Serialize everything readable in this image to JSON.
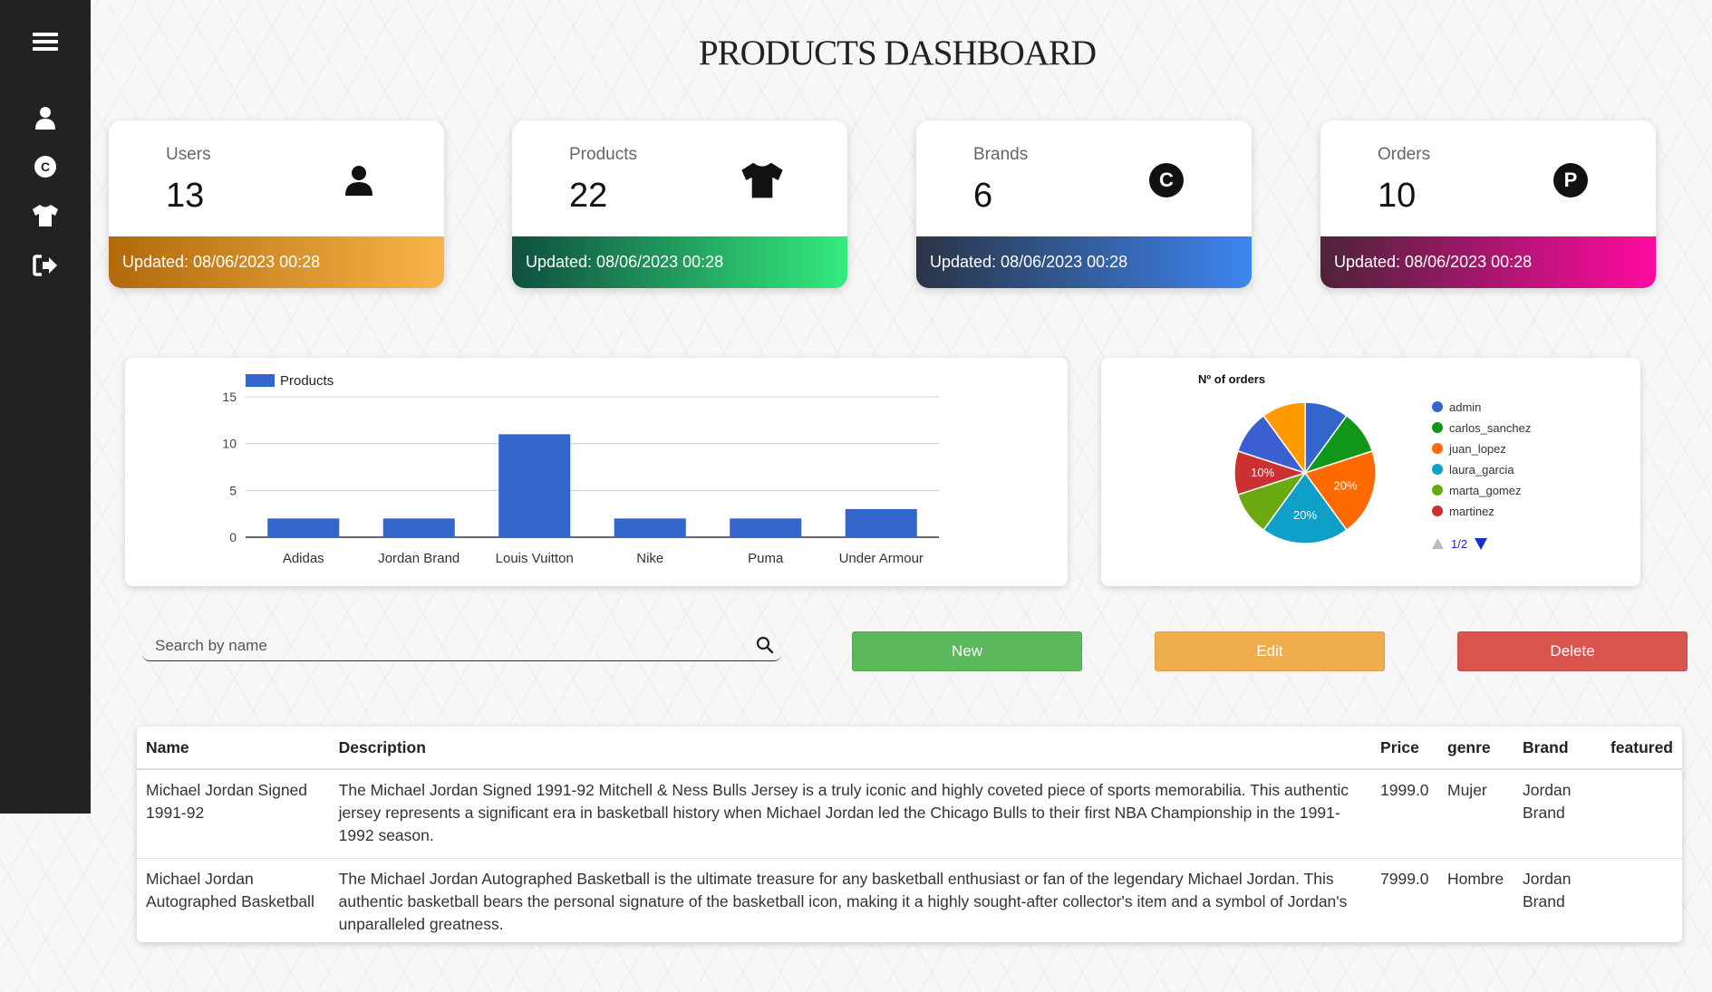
{
  "page": {
    "title": "PRODUCTS DASHBOARD"
  },
  "sidebar": {
    "items": [
      {
        "icon": "menu-icon"
      },
      {
        "icon": "user-icon"
      },
      {
        "icon": "copyright-brand-icon"
      },
      {
        "icon": "tshirt-icon"
      },
      {
        "icon": "logout-icon"
      }
    ]
  },
  "stats": [
    {
      "label": "Users",
      "value": "13",
      "icon": "user-icon",
      "updated": "Updated: 08/06/2023 00:28",
      "colors": [
        "#b06a0c",
        "#f9b449"
      ]
    },
    {
      "label": "Products",
      "value": "22",
      "icon": "tshirt-icon",
      "updated": "Updated: 08/06/2023 00:28",
      "colors": [
        "#0f4f3f",
        "#34ec7e"
      ]
    },
    {
      "label": "Brands",
      "value": "6",
      "icon": "copyright-icon",
      "updated": "Updated: 08/06/2023 00:28",
      "colors": [
        "#2a3445",
        "#3d85f1"
      ]
    },
    {
      "label": "Orders",
      "value": "10",
      "icon": "p-circle-icon",
      "updated": "Updated: 08/06/2023 00:28",
      "colors": [
        "#4e2339",
        "#ff0aa0"
      ]
    }
  ],
  "chart_data": [
    {
      "type": "bar",
      "categories": [
        "Adidas",
        "Jordan Brand",
        "Louis Vuitton",
        "Nike",
        "Puma",
        "Under Armour"
      ],
      "series": [
        {
          "name": "Products",
          "values": [
            2,
            2,
            11,
            2,
            2,
            3
          ],
          "color": "#3366cc"
        }
      ],
      "yticks": [
        "0",
        "5",
        "10",
        "15"
      ],
      "ylim": [
        0,
        15
      ],
      "legend": "top-left",
      "grid": true
    },
    {
      "type": "pie",
      "title": "Nº of orders",
      "slices": [
        {
          "name": "admin",
          "value": 1,
          "color": "#3366cc"
        },
        {
          "name": "carlos_sanchez",
          "value": 1,
          "color": "#109618"
        },
        {
          "name": "juan_lopez",
          "value": 2,
          "color": "#ff6a00",
          "label": "20%"
        },
        {
          "name": "laura_garcia",
          "value": 2,
          "color": "#0ea0c7",
          "label": "20%"
        },
        {
          "name": "marta_gomez",
          "value": 1,
          "color": "#6aaa10"
        },
        {
          "name": "martinez",
          "value": 1,
          "color": "#cc3030",
          "label": "10%"
        },
        {
          "name": "",
          "value": 1,
          "color": "#3b5fd0"
        },
        {
          "name": "",
          "value": 1,
          "color": "#ff9900"
        }
      ],
      "legend": "right",
      "legend_page": "1/2"
    }
  ],
  "search": {
    "placeholder": "Search by name"
  },
  "actions": {
    "new_label": "New",
    "new_color": "#5cb85c",
    "edit_label": "Edit",
    "edit_color": "#f0ad4e",
    "delete_label": "Delete",
    "delete_color": "#d9534f"
  },
  "table": {
    "headers": [
      "Name",
      "Description",
      "Price",
      "genre",
      "Brand",
      "featured"
    ],
    "rows": [
      {
        "name": "Michael Jordan Signed 1991-92",
        "description": "The Michael Jordan Signed 1991-92 Mitchell & Ness Bulls Jersey is a truly iconic and highly coveted piece of sports memorabilia. This authentic jersey represents a significant era in basketball history when Michael Jordan led the Chicago Bulls to their first NBA Championship in the 1991-1992 season.",
        "price": "1999.0",
        "genre": "Mujer",
        "brand": "Jordan Brand",
        "featured": ""
      },
      {
        "name": "Michael Jordan Autographed Basketball",
        "description": "The Michael Jordan Autographed Basketball is the ultimate treasure for any basketball enthusiast or fan of the legendary Michael Jordan. This authentic basketball bears the personal signature of the basketball icon, making it a highly sought-after collector's item and a symbol of Jordan's unparalleled greatness.",
        "price": "7999.0",
        "genre": "Hombre",
        "brand": "Jordan Brand",
        "featured": ""
      }
    ]
  }
}
